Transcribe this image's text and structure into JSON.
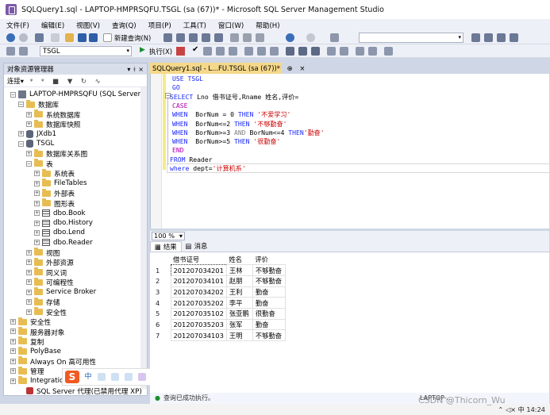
{
  "window": {
    "title": "SQLQuery1.sql - LAPTOP-HMPRSQFU.TSGL (sa (67))* - Microsoft SQL Server Management Studio"
  },
  "menu": [
    "文件(F)",
    "编辑(E)",
    "视图(V)",
    "查询(Q)",
    "项目(P)",
    "工具(T)",
    "窗口(W)",
    "帮助(H)"
  ],
  "toolbar": {
    "new_query": "新建查询(N)",
    "database": "TSGL",
    "execute": "执行(X)"
  },
  "object_explorer": {
    "title": "对象资源管理器",
    "connect": "连接",
    "pin": "▾ ᚼ ×",
    "tree": [
      {
        "exp": "−",
        "icon": "server",
        "label": "LAPTOP-HMPRSQFU (SQL Server"
      },
      {
        "exp": "−",
        "icon": "folder",
        "label": "数据库"
      },
      {
        "exp": "+",
        "icon": "folder",
        "label": "系统数据库"
      },
      {
        "exp": "+",
        "icon": "folder",
        "label": "数据库快照"
      },
      {
        "exp": "+",
        "icon": "db",
        "label": "JXdb1"
      },
      {
        "exp": "−",
        "icon": "db",
        "label": "TSGL"
      },
      {
        "exp": "+",
        "icon": "folder",
        "label": "数据库关系图"
      },
      {
        "exp": "−",
        "icon": "folder",
        "label": "表"
      },
      {
        "exp": "+",
        "icon": "folder",
        "label": "系统表"
      },
      {
        "exp": "+",
        "icon": "folder",
        "label": "FileTables"
      },
      {
        "exp": "+",
        "icon": "folder",
        "label": "外部表"
      },
      {
        "exp": "+",
        "icon": "folder",
        "label": "图形表"
      },
      {
        "exp": "+",
        "icon": "table",
        "label": "dbo.Book"
      },
      {
        "exp": "+",
        "icon": "table",
        "label": "dbo.History"
      },
      {
        "exp": "+",
        "icon": "table",
        "label": "dbo.Lend"
      },
      {
        "exp": "+",
        "icon": "table",
        "label": "dbo.Reader"
      },
      {
        "exp": "+",
        "icon": "folder",
        "label": "视图"
      },
      {
        "exp": "+",
        "icon": "folder",
        "label": "外部资源"
      },
      {
        "exp": "+",
        "icon": "folder",
        "label": "同义词"
      },
      {
        "exp": "+",
        "icon": "folder",
        "label": "可编程性"
      },
      {
        "exp": "+",
        "icon": "folder",
        "label": "Service Broker"
      },
      {
        "exp": "+",
        "icon": "folder",
        "label": "存储"
      },
      {
        "exp": "+",
        "icon": "folder",
        "label": "安全性"
      },
      {
        "exp": "+",
        "icon": "folder",
        "label": "安全性"
      },
      {
        "exp": "+",
        "icon": "folder",
        "label": "服务器对象"
      },
      {
        "exp": "+",
        "icon": "folder",
        "label": "复制"
      },
      {
        "exp": "+",
        "icon": "folder",
        "label": "PolyBase"
      },
      {
        "exp": "+",
        "icon": "folder",
        "label": "Always On 高可用性"
      },
      {
        "exp": "+",
        "icon": "folder",
        "label": "管理"
      },
      {
        "exp": "+",
        "icon": "folder",
        "label": "Integratio"
      },
      {
        "exp": "",
        "icon": "agent",
        "label": "SQL Server 代理(已禁用代理 XP)"
      }
    ]
  },
  "doc_tab": {
    "label": "SQLQuery1.sql - L...FU.TSGL (sa (67))*",
    "pin": "⊕",
    "close": "×"
  },
  "editor": {
    "l1": "USE TSGL",
    "l2": "GO",
    "l3a": "SELECT",
    "l3b": " Lno 借书证号,Rname 姓名,评价=",
    "l4": "CASE",
    "l5a": "WHEN",
    "l5b": "  BorNum = 0 ",
    "l5c": "THEN",
    "l5d": " '不爱学习'",
    "l6a": "WHEN",
    "l6b": "  BorNum<=2 ",
    "l6c": "THEN",
    "l6d": " '不够勤奋'",
    "l7a": "WHEN",
    "l7b": "  BorNum>=3 ",
    "l7c": "AND",
    "l7d": " BorNum<=4 ",
    "l7e": "THEN",
    "l7f": "'勤奋'",
    "l8a": "WHEN",
    "l8b": "  BorNum>=5 ",
    "l8c": "THEN",
    "l8d": " '很勤奋'",
    "l9": "END",
    "l10a": "FROM",
    "l10b": " Reader",
    "l11a": "where",
    "l11b": " dept=",
    "l11c": "'计算机系'"
  },
  "zoom": "100 %",
  "results_tabs": {
    "results": "结果",
    "messages": "消息"
  },
  "results": {
    "columns": [
      "借书证号",
      "姓名",
      "评价"
    ],
    "rows": [
      [
        "1",
        "201207034201",
        "王林",
        "不够勤奋"
      ],
      [
        "2",
        "201207034101",
        "赵朋",
        "不够勤奋"
      ],
      [
        "3",
        "201207034202",
        "王利",
        "勤奋"
      ],
      [
        "4",
        "201207035202",
        "李平",
        "勤奋"
      ],
      [
        "5",
        "201207035102",
        "张亚鹏",
        "很勤奋"
      ],
      [
        "6",
        "201207035203",
        "张军",
        "勤奋"
      ],
      [
        "7",
        "201207034103",
        "王明",
        "不够勤奋"
      ]
    ]
  },
  "status": {
    "text": "查询已成功执行。",
    "server": "LAPTOP-..."
  },
  "taskbar": {
    "time": "14:24",
    "ime_indicator": "中",
    "watermark": "CSDN @Thicorn_Wu"
  }
}
